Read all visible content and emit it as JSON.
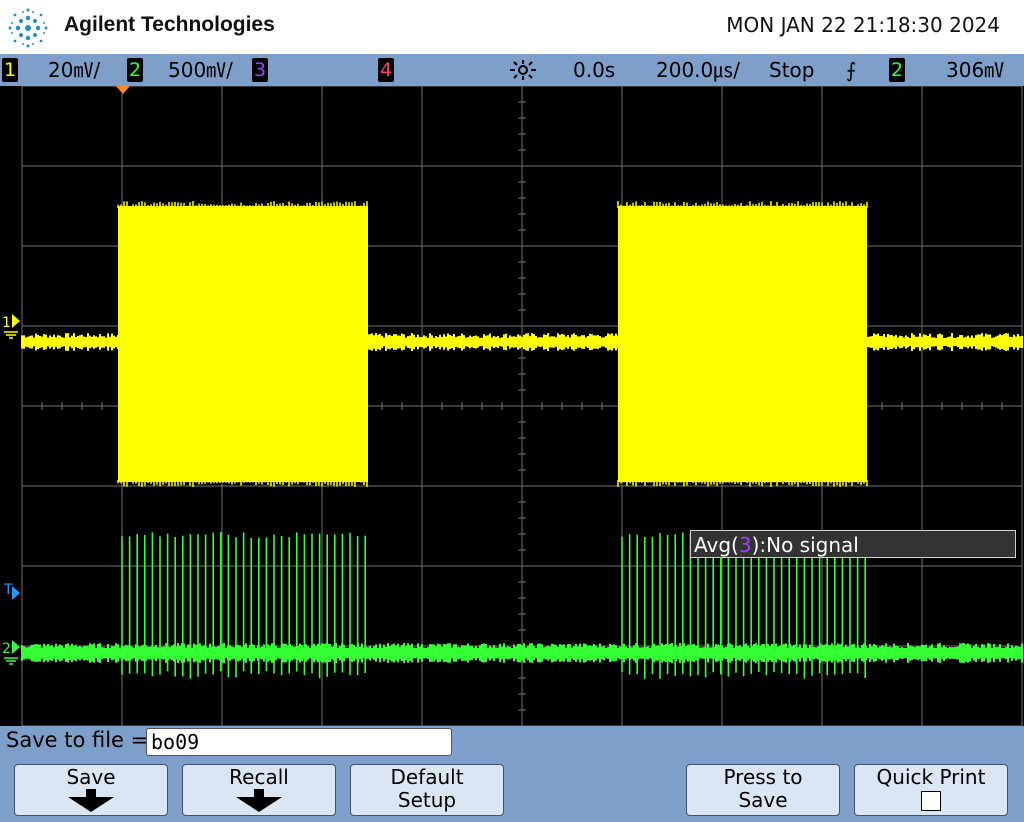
{
  "header": {
    "brand": "Agilent Technologies",
    "datetime": "MON JAN 22 21:18:30 2024"
  },
  "status": {
    "ch1": {
      "num": "1",
      "scale": "20㎷/",
      "color": "#ffff00"
    },
    "ch2": {
      "num": "2",
      "scale": "500㎷/",
      "color": "#33ff33"
    },
    "ch3": {
      "num": "3",
      "color": "#a040ff"
    },
    "ch4": {
      "num": "4",
      "color": "#ff3c6e"
    },
    "delay": "0.0s",
    "timebase": "200.0㎲/",
    "run_state": "Stop",
    "trigger_slope": "⨍",
    "trigger_channel": "2",
    "trigger_level": "306㎷"
  },
  "screen": {
    "markers": {
      "ch1": "1",
      "ch2": "2",
      "trigger": "T"
    },
    "popup": {
      "prefix": "Avg(",
      "channel": "3",
      "suffix": "):No signal"
    }
  },
  "bottom": {
    "save_label": "Save to file =",
    "filename": "bo09",
    "softkeys": {
      "save": "Save",
      "recall": "Recall",
      "default_line1": "Default",
      "default_line2": "Setup",
      "press_line1": "Press to",
      "press_line2": "Save",
      "quick_print": "Quick Print"
    }
  },
  "colors": {
    "ch1": "#ffff00",
    "ch2": "#33ff33",
    "grid": "#707070",
    "accent": "#7d9fc9"
  }
}
